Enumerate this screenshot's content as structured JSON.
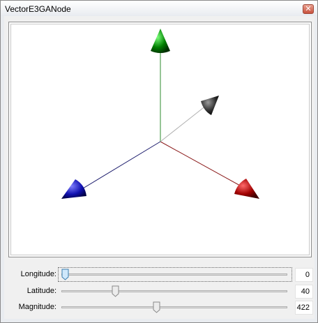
{
  "window": {
    "title": "VectorE3GANode",
    "close_glyph": "✕"
  },
  "viewport": {
    "axes": [
      {
        "name": "x-axis",
        "color": "#a00000",
        "line_color": "#8b1a1a"
      },
      {
        "name": "y-axis",
        "color": "#008000",
        "line_color": "#2e8b2e"
      },
      {
        "name": "z-axis",
        "color": "#1010b0",
        "line_color": "#1a1a6b"
      }
    ],
    "vector": {
      "color": "#303030",
      "line_color": "#b0b0b0"
    }
  },
  "controls": [
    {
      "label": "Longitude:",
      "value": "0",
      "fraction": 0.0
    },
    {
      "label": "Latitude:",
      "value": "40",
      "fraction": 0.23
    },
    {
      "label": "Magnitude:",
      "value": "422",
      "fraction": 0.42
    }
  ]
}
